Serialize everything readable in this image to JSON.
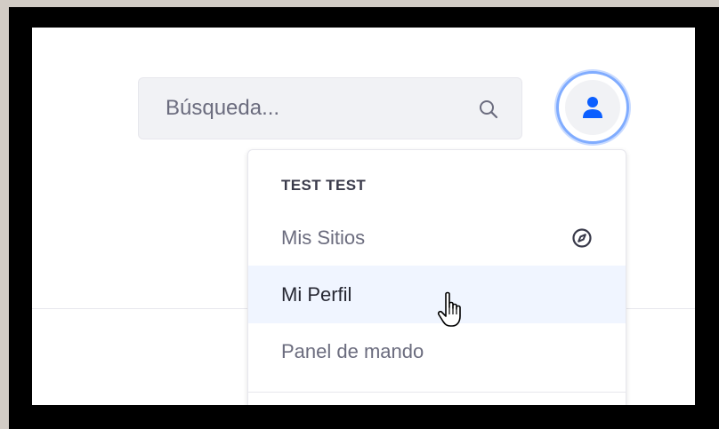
{
  "search": {
    "placeholder": "Búsqueda..."
  },
  "user_menu": {
    "header": "TEST TEST",
    "items": [
      {
        "label": "Mis Sitios",
        "icon": "compass-icon"
      },
      {
        "label": "Mi Perfil",
        "state": "hover"
      },
      {
        "label": "Panel de mando"
      }
    ]
  },
  "icons": {
    "search": "search-icon",
    "avatar": "user-icon",
    "cursor": "hand-pointer-icon"
  },
  "colors": {
    "accent": "#80acff",
    "avatar_icon": "#0b5fff",
    "hover_bg": "#f0f5ff",
    "text_secondary": "#6b6c7e",
    "text_primary": "#272833"
  }
}
